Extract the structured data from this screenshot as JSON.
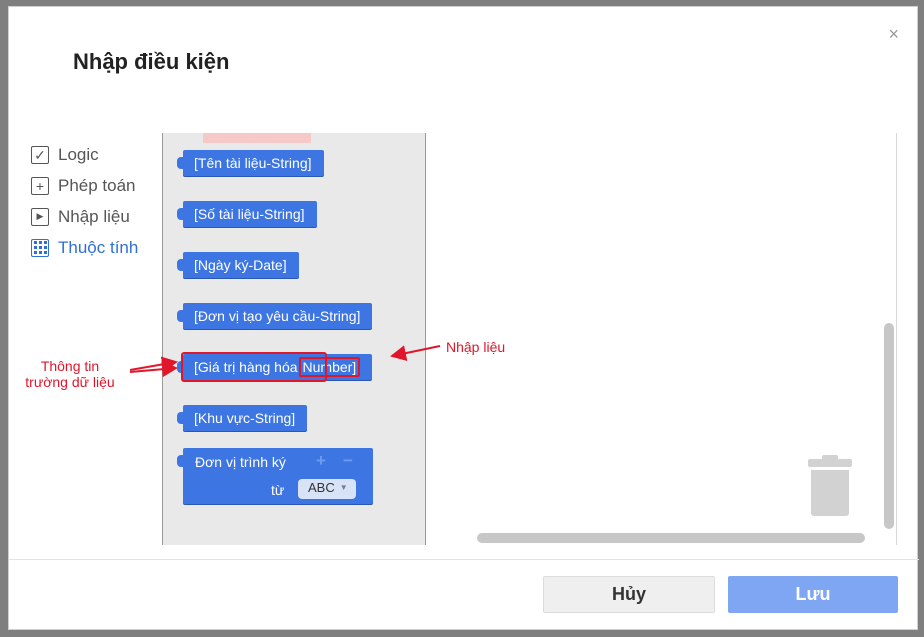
{
  "dialog": {
    "title": "Nhập điều kiện",
    "close_glyph": "×"
  },
  "categories": [
    {
      "label": "Logic",
      "icon": "checkbox-icon",
      "active": false
    },
    {
      "label": "Phép toán",
      "icon": "plus-box-icon",
      "active": false
    },
    {
      "label": "Nhập liệu",
      "icon": "play-box-icon",
      "active": false
    },
    {
      "label": "Thuộc tính",
      "icon": "grid-icon",
      "active": true
    }
  ],
  "blocks": [
    {
      "label": "[Tên tài liệu-String]"
    },
    {
      "label": "[Số tài liệu-String]"
    },
    {
      "label": "[Ngày ký-Date]"
    },
    {
      "label": "[Đơn vị tạo yêu cầu-String]"
    },
    {
      "label_part1": "[Giá trị hàng hóa",
      "label_part2": "Number]"
    },
    {
      "label": "[Khu vực-String]"
    }
  ],
  "big_block": {
    "title": "Đơn vị trình ký",
    "plus": "+",
    "minus": "−",
    "from_label": "từ",
    "select_value": "ABC"
  },
  "annotations": {
    "left_text": "Thông tin\ntrường dữ liệu",
    "right_text": "Nhập liệu"
  },
  "footer": {
    "cancel_label": "Hủy",
    "save_label": "Lưu"
  },
  "colors": {
    "block": "#3d76e3",
    "accent": "#2f6fd6",
    "annotation": "#e0162b",
    "save_button": "#7fa6f3"
  }
}
